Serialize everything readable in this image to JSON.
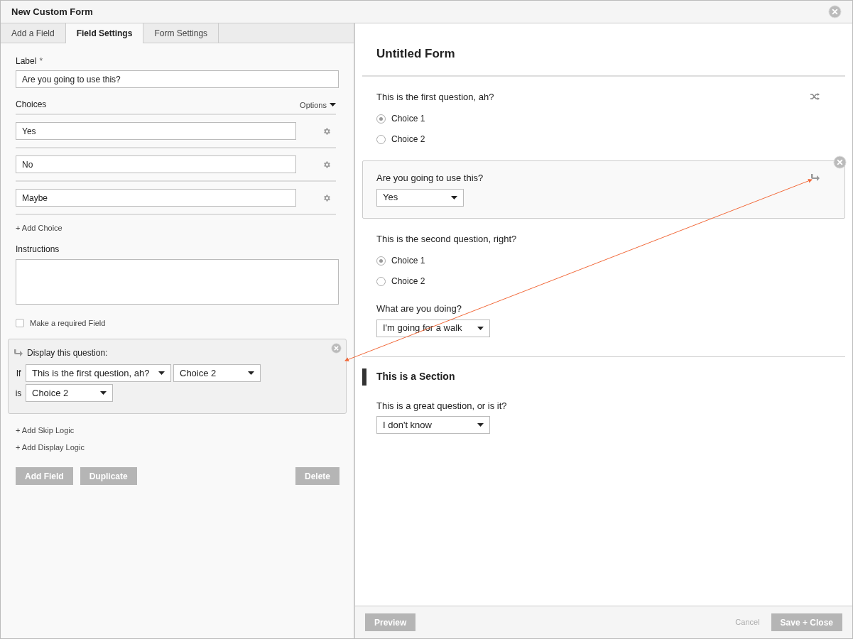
{
  "window": {
    "title": "New Custom Form"
  },
  "tabs": [
    {
      "label": "Add a Field",
      "selected": false
    },
    {
      "label": "Field Settings",
      "selected": true
    },
    {
      "label": "Form Settings",
      "selected": false
    }
  ],
  "field_settings": {
    "label_title": "Label",
    "required_mark": "*",
    "label_value": "Are you going to use this?",
    "choices_title": "Choices",
    "options_menu": "Options",
    "choices": [
      {
        "value": "Yes"
      },
      {
        "value": "No"
      },
      {
        "value": "Maybe"
      }
    ],
    "add_choice": "+ Add Choice",
    "instructions_title": "Instructions",
    "required_checkbox": {
      "label": "Make a required Field",
      "checked": false
    },
    "display_logic": {
      "title": "Display this question:",
      "if_label": "If",
      "question": "This is the first question, ah?",
      "answer": "Choice 2",
      "is_label": "is",
      "value": "Choice 2"
    },
    "links": [
      "+ Add Skip Logic",
      "+ Add Display Logic"
    ],
    "buttons": [
      "Add Field",
      "Duplicate"
    ],
    "delete_button": "Delete"
  },
  "preview": {
    "title": "Untitled Form",
    "items": [
      {
        "kind": "radio",
        "question": "This is the first question, ah?",
        "selected": false,
        "randomized": true,
        "has_logic": false,
        "options": [
          {
            "label": "Choice 1",
            "selected": true
          },
          {
            "label": "Choice 2",
            "selected": false
          }
        ]
      },
      {
        "kind": "select",
        "question": "Are you going to use this?",
        "value": "Yes",
        "selected": true,
        "randomized": false,
        "has_logic": true
      },
      {
        "kind": "radio",
        "question": "This is the second question, right?",
        "selected": false,
        "randomized": false,
        "has_logic": false,
        "options": [
          {
            "label": "Choice 1",
            "selected": true
          },
          {
            "label": "Choice 2",
            "selected": false
          }
        ]
      },
      {
        "kind": "select",
        "question": "What are you doing?",
        "value": "I'm going for a walk",
        "selected": false,
        "randomized": false,
        "has_logic": false
      },
      {
        "kind": "section",
        "title": "This is a Section"
      },
      {
        "kind": "select",
        "question": "This is a great question, or is it?",
        "value": "I don't know",
        "selected": false,
        "randomized": false,
        "has_logic": false
      }
    ]
  },
  "footer": {
    "preview_button": "Preview",
    "cancel": "Cancel",
    "save_button": "Save + Close"
  }
}
